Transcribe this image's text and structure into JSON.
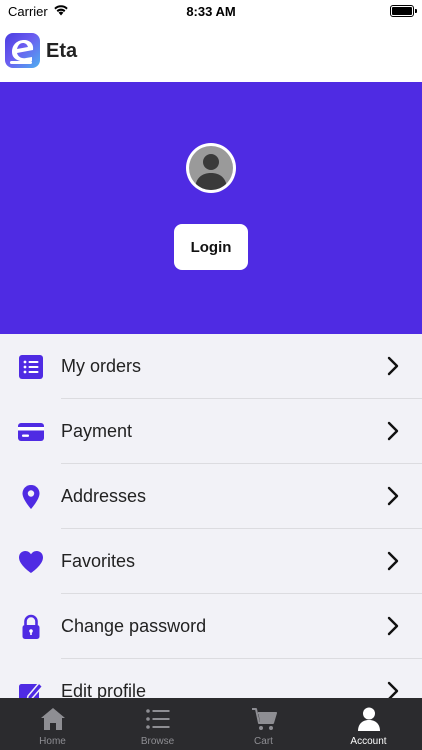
{
  "status_bar": {
    "carrier": "Carrier",
    "time": "8:33 AM"
  },
  "header": {
    "title": "Eta",
    "logo_letter": "e"
  },
  "hero": {
    "login_label": "Login",
    "background": "#4f2be3"
  },
  "menu": {
    "items": [
      {
        "label": "My orders",
        "icon": "list-icon"
      },
      {
        "label": "Payment",
        "icon": "credit-card-icon"
      },
      {
        "label": "Addresses",
        "icon": "location-pin-icon"
      },
      {
        "label": "Favorites",
        "icon": "heart-icon"
      },
      {
        "label": "Change password",
        "icon": "lock-icon"
      },
      {
        "label": "Edit profile",
        "icon": "edit-icon"
      }
    ]
  },
  "tabs": [
    {
      "label": "Home",
      "icon": "home-icon",
      "active": false
    },
    {
      "label": "Browse",
      "icon": "browse-list-icon",
      "active": false
    },
    {
      "label": "Cart",
      "icon": "cart-icon",
      "active": false
    },
    {
      "label": "Account",
      "icon": "account-icon",
      "active": true
    }
  ],
  "colors": {
    "accent": "#4f2be3",
    "tab_bar": "#2b2b2e",
    "tab_inactive": "#8e8e93",
    "tab_active": "#ffffff"
  }
}
